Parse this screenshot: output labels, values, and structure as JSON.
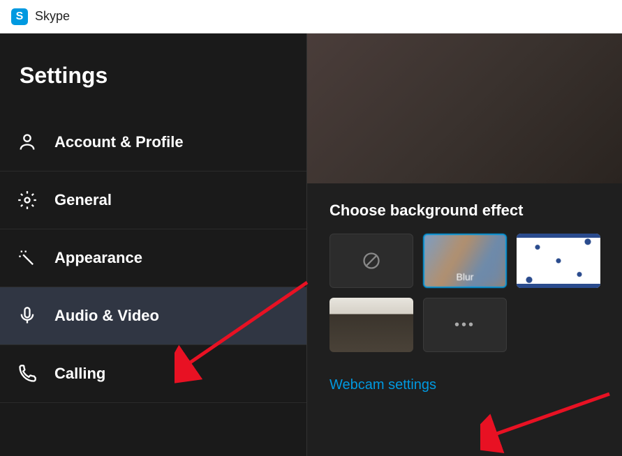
{
  "app": {
    "title": "Skype",
    "logo_letter": "S"
  },
  "sidebar": {
    "header": "Settings",
    "items": [
      {
        "label": "Account & Profile"
      },
      {
        "label": "General"
      },
      {
        "label": "Appearance"
      },
      {
        "label": "Audio & Video"
      },
      {
        "label": "Calling"
      }
    ]
  },
  "main": {
    "section_title": "Choose background effect",
    "effects": {
      "blur_label": "Blur"
    },
    "webcam_link": "Webcam settings"
  }
}
